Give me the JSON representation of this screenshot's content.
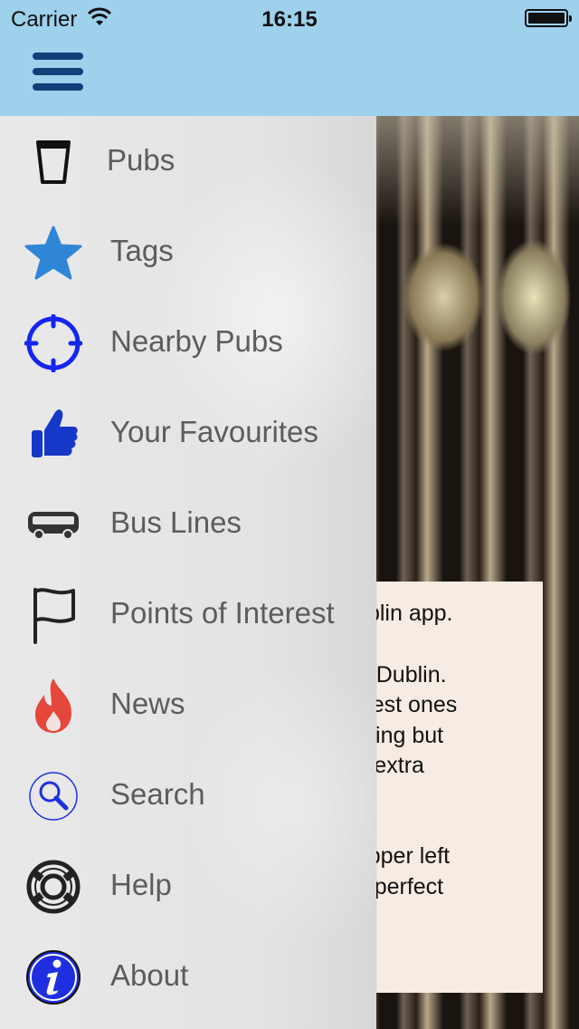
{
  "status_bar": {
    "carrier": "Carrier",
    "time": "16:15"
  },
  "nav": {
    "menu_button": "hamburger-menu"
  },
  "menu": {
    "items": [
      {
        "label": "Pubs",
        "icon": "pint-glass-icon"
      },
      {
        "label": "Tags",
        "icon": "star-icon"
      },
      {
        "label": "Nearby Pubs",
        "icon": "crosshair-icon"
      },
      {
        "label": "Your Favourites",
        "icon": "thumbs-up-icon"
      },
      {
        "label": "Bus Lines",
        "icon": "bus-icon"
      },
      {
        "label": "Points of Interest",
        "icon": "flag-icon"
      },
      {
        "label": "News",
        "icon": "flame-icon"
      },
      {
        "label": "Search",
        "icon": "search-icon"
      },
      {
        "label": "Help",
        "icon": "lifebuoy-icon"
      },
      {
        "label": "About",
        "icon": "info-icon"
      }
    ]
  },
  "intro_card": {
    "lines": [
      "Dublin app.",
      "os in Dublin.",
      "e best ones",
      "visiting but",
      "as extra",
      "e upper left",
      "the perfect"
    ]
  },
  "colors": {
    "nav_bar": "#9dd1ec",
    "menu_icon": "#123f7a",
    "star": "#2f86d6",
    "crosshair": "#1426f0",
    "thumb": "#1638c8",
    "flame": "#e5473a",
    "info": "#1f2fe0"
  }
}
